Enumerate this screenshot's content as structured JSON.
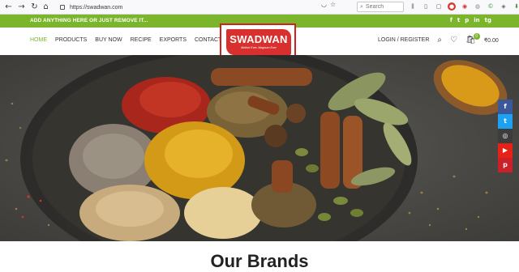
{
  "browser": {
    "url": "https://swadwan.com",
    "search_placeholder": "Search",
    "back": "←",
    "forward": "→",
    "reload": "↻",
    "home": "⌂"
  },
  "promo": {
    "text": "ADD ANYTHING HERE OR JUST REMOVE IT...",
    "social": [
      "f",
      "t",
      "p",
      "in",
      "tg"
    ]
  },
  "nav": {
    "items": [
      "HOME",
      "PRODUCTS",
      "BUY NOW",
      "RECIPE",
      "EXPORTS",
      "CONTACT"
    ],
    "active_index": 0
  },
  "logo": {
    "name": "SWADWAN",
    "tagline": "Mother Ever, Magnum Ever"
  },
  "header_right": {
    "login": "LOGIN / REGISTER",
    "cart_count": "0",
    "cart_total": "₹0.00"
  },
  "side_social": [
    {
      "icon": "facebook-icon",
      "glyph": "f",
      "color": "#3b5998"
    },
    {
      "icon": "twitter-icon",
      "glyph": "t",
      "color": "#1da1f2"
    },
    {
      "icon": "instagram-icon",
      "glyph": "◎",
      "color": "#3d3d3d"
    },
    {
      "icon": "youtube-icon",
      "glyph": "▶",
      "color": "#e62117"
    },
    {
      "icon": "pinterest-icon",
      "glyph": "p",
      "color": "#cb2027"
    }
  ],
  "section": {
    "heading": "Our Brands"
  },
  "colors": {
    "accent": "#7bb52c",
    "logo_red": "#d8302e"
  }
}
